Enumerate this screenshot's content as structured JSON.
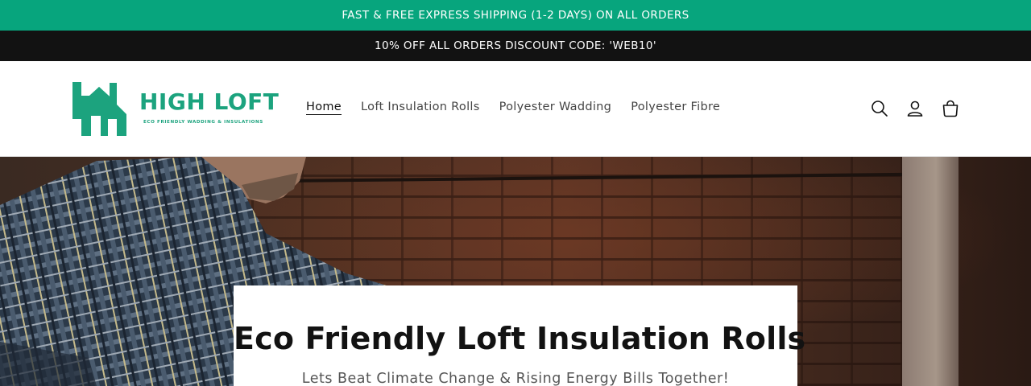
{
  "announcements": {
    "shipping": "FAST & FREE EXPRESS SHIPPING (1-2 DAYS) ON ALL ORDERS",
    "discount": "10% OFF ALL ORDERS DISCOUNT CODE: 'WEB10'"
  },
  "brand": {
    "name": "HIGH LOFT",
    "tagline": "ECO FRIENDLY WADDING & INSULATIONS",
    "color": "#1ca37e"
  },
  "nav": {
    "items": [
      {
        "label": "Home",
        "active": true
      },
      {
        "label": "Loft Insulation Rolls",
        "active": false
      },
      {
        "label": "Polyester Wadding",
        "active": false
      },
      {
        "label": "Polyester Fibre",
        "active": false
      }
    ]
  },
  "header_icons": [
    "search-icon",
    "account-icon",
    "cart-icon"
  ],
  "hero": {
    "title": "Eco Friendly Loft Insulation Rolls",
    "subtitle": "Lets Beat Climate Change & Rising Energy Bills Together!"
  },
  "colors": {
    "announcement_green": "#07a57d",
    "announcement_dark": "#121212",
    "brand_green": "#1ca37e"
  }
}
